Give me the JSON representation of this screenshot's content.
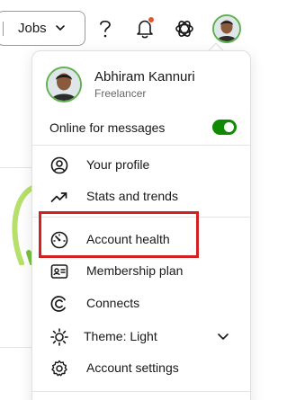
{
  "topbar": {
    "jobs_label": "Jobs",
    "icons": [
      "chevron-down-icon",
      "help-icon",
      "bell-icon",
      "ai-sparkle-icon"
    ]
  },
  "menu": {
    "profile": {
      "name": "Abhiram Kannuri",
      "role": "Freelancer"
    },
    "online": {
      "label": "Online for messages",
      "enabled": true
    },
    "items": [
      {
        "label": "Your profile",
        "icon": "user-circle-icon"
      },
      {
        "label": "Stats and trends",
        "icon": "trending-up-icon"
      },
      {
        "label": "Account health",
        "icon": "gauge-icon"
      },
      {
        "label": "Membership plan",
        "icon": "id-card-icon"
      },
      {
        "label": "Connects",
        "icon": "connects-icon"
      },
      {
        "label": "Theme: Light",
        "icon": "sun-icon"
      },
      {
        "label": "Account settings",
        "icon": "gear-icon"
      }
    ]
  },
  "colors": {
    "accent": "#108a00",
    "highlight": "#d32020",
    "notification": "#e4572e"
  }
}
